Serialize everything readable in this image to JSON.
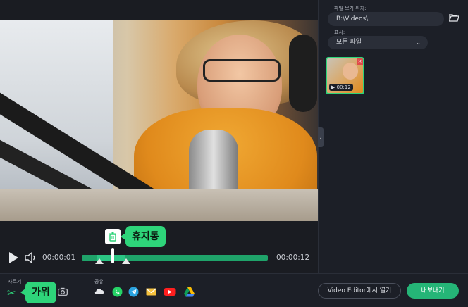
{
  "player": {
    "time_current": "00:00:01",
    "time_total": "00:00:12",
    "trash_tooltip": "휴지통"
  },
  "right_panel": {
    "location_label": "파일 보기 위치:",
    "path_value": "B:\\Videos\\",
    "view_label": "표시:",
    "view_value": "모든 파일",
    "thumbnail_duration": "▶ 00:12"
  },
  "bottom": {
    "cut_label": "자르기",
    "scissors_tooltip": "가위",
    "share_label": "공유",
    "open_editor_label": "Video Editor에서 열기",
    "export_label": "내보내기"
  },
  "colors": {
    "accent": "#2ed47a",
    "timeline": "#1fa36a",
    "background": "#1c1f27"
  },
  "icons": [
    "play-icon",
    "volume-icon",
    "trash-icon",
    "folder-icon",
    "scissors-icon",
    "camera-icon",
    "cloud-icon",
    "whatsapp-icon",
    "telegram-icon",
    "mail-icon",
    "youtube-icon",
    "google-drive-icon"
  ]
}
